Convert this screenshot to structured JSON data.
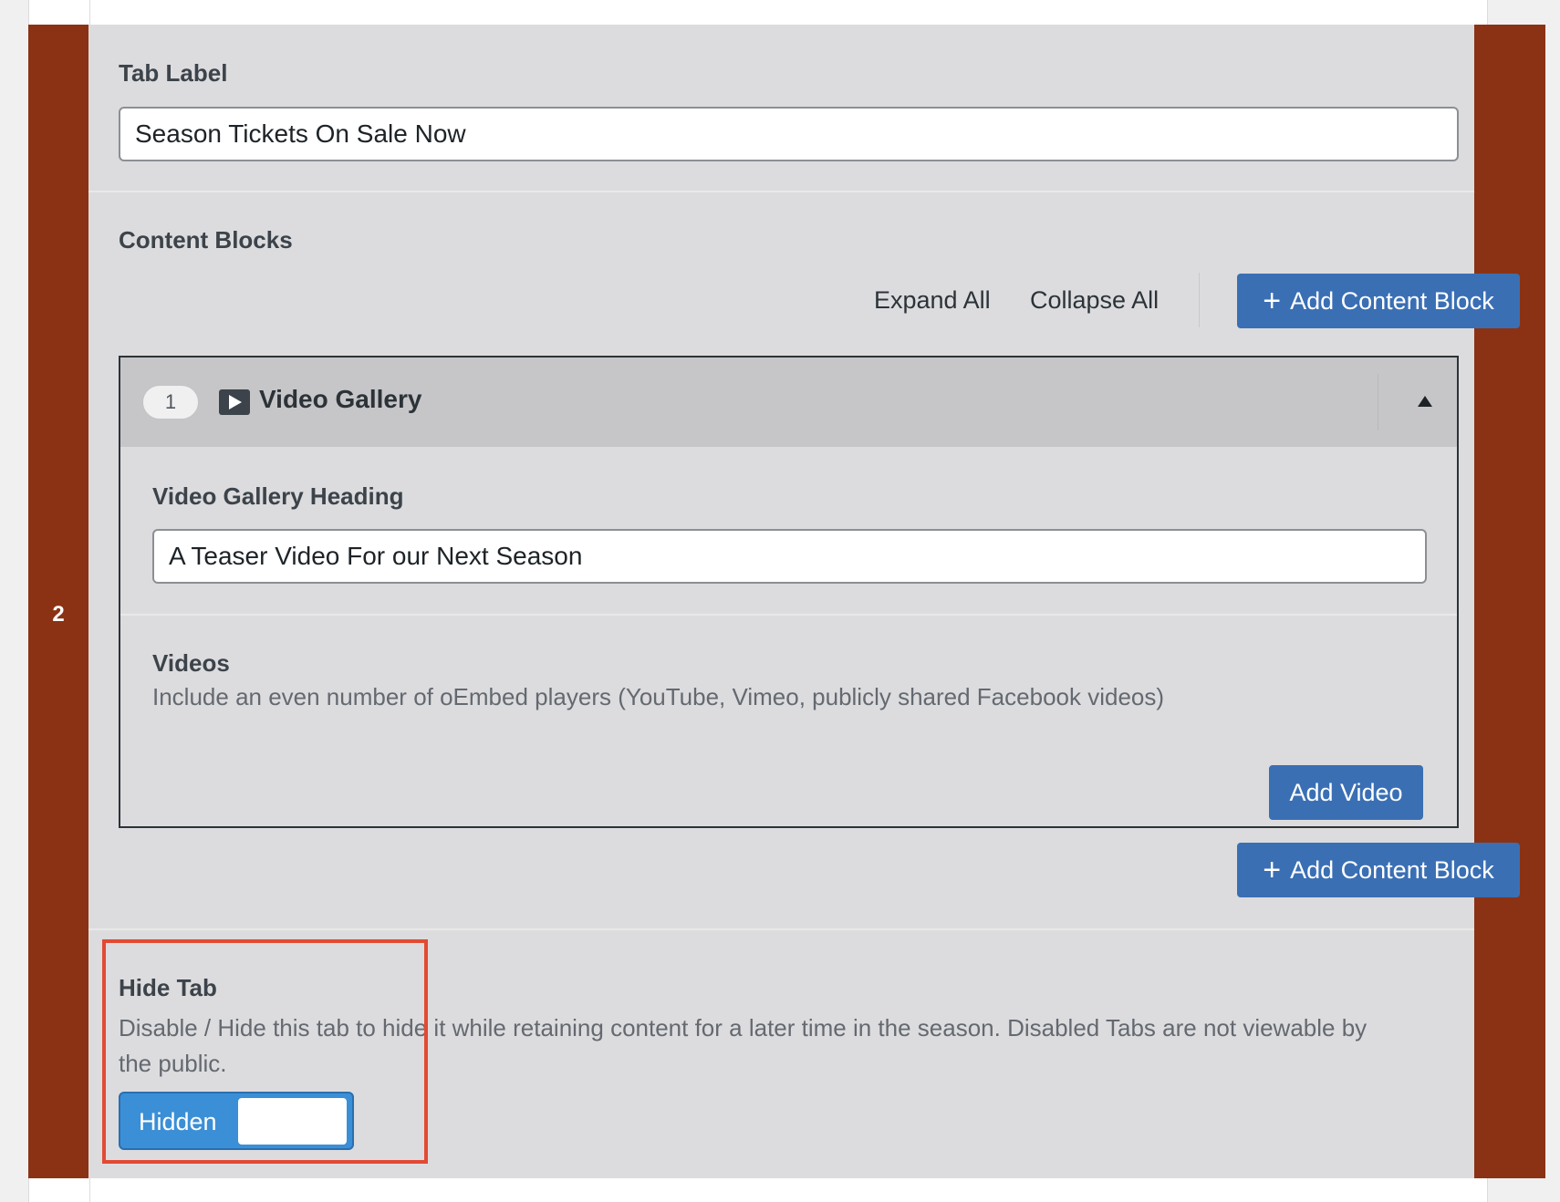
{
  "row": {
    "number": "2"
  },
  "tab_label": {
    "label": "Tab Label",
    "value": "Season Tickets On Sale Now"
  },
  "content_blocks": {
    "label": "Content Blocks",
    "expand_all": "Expand All",
    "collapse_all": "Collapse All",
    "add_label": "Add Content Block",
    "add_label_bottom": "Add Content Block"
  },
  "block": {
    "order": "1",
    "icon": "video-play-icon",
    "title": "Video Gallery",
    "heading_label": "Video Gallery Heading",
    "heading_value": "A Teaser Video For our Next Season",
    "videos_label": "Videos",
    "videos_desc": "Include an even number of oEmbed players (YouTube, Vimeo, publicly shared Facebook videos)",
    "add_video": "Add Video"
  },
  "hide_tab": {
    "label": "Hide Tab",
    "desc": "Disable / Hide this tab to hide it while retaining content for a later time in the season. Disabled Tabs are not viewable by the public.",
    "toggle_label": "Hidden"
  },
  "colors": {
    "row_handle": "#8b3214",
    "primary": "#3a6fb4",
    "toggle_on": "#3b8fd6",
    "highlight": "#e24a33"
  }
}
